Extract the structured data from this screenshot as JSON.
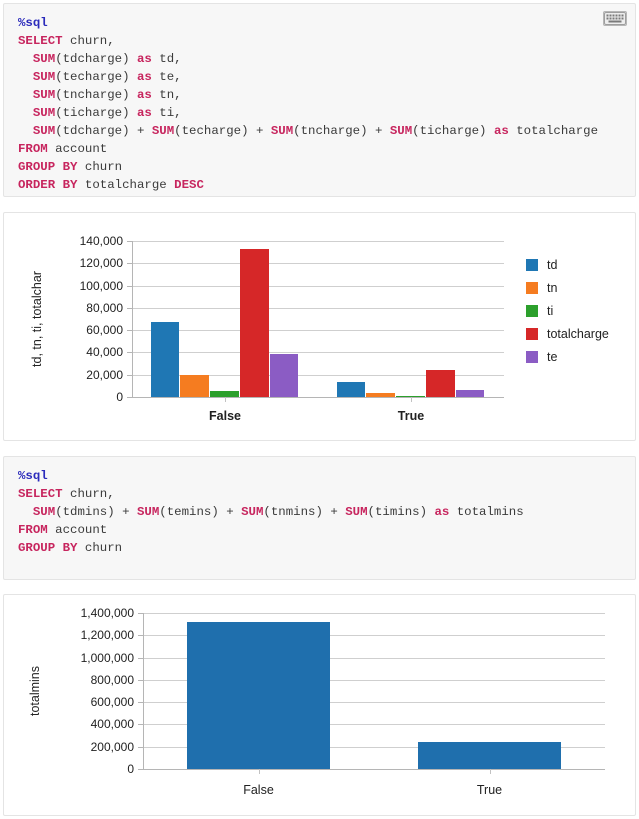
{
  "notebook": {
    "keyboard_icon": "keyboard-icon"
  },
  "cells": [
    {
      "type": "code",
      "name": "sql-cell-1",
      "lines": [
        [
          {
            "t": "magic",
            "s": "%sql"
          }
        ],
        [
          {
            "t": "kw",
            "s": "SELECT"
          },
          {
            "t": "plain",
            "s": " churn,"
          }
        ],
        [
          {
            "t": "plain",
            "s": "  "
          },
          {
            "t": "fn",
            "s": "SUM"
          },
          {
            "t": "plain",
            "s": "(tdcharge) "
          },
          {
            "t": "kw",
            "s": "as"
          },
          {
            "t": "plain",
            "s": " td,"
          }
        ],
        [
          {
            "t": "plain",
            "s": "  "
          },
          {
            "t": "fn",
            "s": "SUM"
          },
          {
            "t": "plain",
            "s": "(techarge) "
          },
          {
            "t": "kw",
            "s": "as"
          },
          {
            "t": "plain",
            "s": " te,"
          }
        ],
        [
          {
            "t": "plain",
            "s": "  "
          },
          {
            "t": "fn",
            "s": "SUM"
          },
          {
            "t": "plain",
            "s": "(tncharge) "
          },
          {
            "t": "kw",
            "s": "as"
          },
          {
            "t": "plain",
            "s": " tn,"
          }
        ],
        [
          {
            "t": "plain",
            "s": "  "
          },
          {
            "t": "fn",
            "s": "SUM"
          },
          {
            "t": "plain",
            "s": "(ticharge) "
          },
          {
            "t": "kw",
            "s": "as"
          },
          {
            "t": "plain",
            "s": " ti,"
          }
        ],
        [
          {
            "t": "plain",
            "s": "  "
          },
          {
            "t": "fn",
            "s": "SUM"
          },
          {
            "t": "plain",
            "s": "(tdcharge) + "
          },
          {
            "t": "fn",
            "s": "SUM"
          },
          {
            "t": "plain",
            "s": "(techarge) + "
          },
          {
            "t": "fn",
            "s": "SUM"
          },
          {
            "t": "plain",
            "s": "(tncharge) + "
          },
          {
            "t": "fn",
            "s": "SUM"
          },
          {
            "t": "plain",
            "s": "(ticharge) "
          },
          {
            "t": "kw",
            "s": "as"
          },
          {
            "t": "plain",
            "s": " totalcharge"
          }
        ],
        [
          {
            "t": "kw",
            "s": "FROM"
          },
          {
            "t": "plain",
            "s": " account"
          }
        ],
        [
          {
            "t": "kw",
            "s": "GROUP BY"
          },
          {
            "t": "plain",
            "s": " churn"
          }
        ],
        [
          {
            "t": "kw",
            "s": "ORDER BY"
          },
          {
            "t": "plain",
            "s": " totalcharge "
          },
          {
            "t": "kw",
            "s": "DESC"
          }
        ]
      ]
    },
    {
      "type": "code",
      "name": "sql-cell-2",
      "lines": [
        [
          {
            "t": "magic",
            "s": "%sql"
          }
        ],
        [
          {
            "t": "kw",
            "s": "SELECT"
          },
          {
            "t": "plain",
            "s": " churn,"
          }
        ],
        [
          {
            "t": "plain",
            "s": "  "
          },
          {
            "t": "fn",
            "s": "SUM"
          },
          {
            "t": "plain",
            "s": "(tdmins) + "
          },
          {
            "t": "fn",
            "s": "SUM"
          },
          {
            "t": "plain",
            "s": "(temins) + "
          },
          {
            "t": "fn",
            "s": "SUM"
          },
          {
            "t": "plain",
            "s": "(tnmins) + "
          },
          {
            "t": "fn",
            "s": "SUM"
          },
          {
            "t": "plain",
            "s": "(timins) "
          },
          {
            "t": "kw",
            "s": "as"
          },
          {
            "t": "plain",
            "s": " totalmins"
          }
        ],
        [
          {
            "t": "kw",
            "s": "FROM"
          },
          {
            "t": "plain",
            "s": " account"
          }
        ],
        [
          {
            "t": "kw",
            "s": "GROUP BY"
          },
          {
            "t": "plain",
            "s": " churn"
          }
        ]
      ]
    }
  ],
  "chart_data": [
    {
      "type": "bar",
      "name": "charges-by-churn",
      "title": "",
      "xlabel": "",
      "ylabel": "td, tn, ti, totalchar",
      "ylabel_full": "td, tn, ti, totalcharge",
      "categories": [
        "False",
        "True"
      ],
      "series": [
        {
          "name": "td",
          "color": "#1f77b4",
          "values": [
            67500,
            13200
          ]
        },
        {
          "name": "tn",
          "color": "#f57c20",
          "values": [
            20100,
            3300
          ]
        },
        {
          "name": "ti",
          "color": "#2ca02c",
          "values": [
            5600,
            1000
          ]
        },
        {
          "name": "totalcharge",
          "color": "#d62728",
          "values": [
            133000,
            24600
          ]
        },
        {
          "name": "te",
          "color": "#8b5cc4",
          "values": [
            38600,
            6300
          ]
        }
      ],
      "ylim": [
        0,
        140000
      ],
      "yticks": [
        0,
        20000,
        40000,
        60000,
        80000,
        100000,
        120000,
        140000
      ],
      "ytick_labels": [
        "0",
        "20,000",
        "40,000",
        "60,000",
        "80,000",
        "100,000",
        "120,000",
        "140,000"
      ],
      "grid": true,
      "legend_position": "right",
      "legend_entries": [
        "td",
        "tn",
        "ti",
        "totalcharge",
        "te"
      ]
    },
    {
      "type": "bar",
      "name": "totalmins-by-churn",
      "title": "",
      "xlabel": "",
      "ylabel": "totalmins",
      "categories": [
        "False",
        "True"
      ],
      "series": [
        {
          "name": "totalmins",
          "color": "#1f6fad",
          "values": [
            1322000,
            240000
          ]
        }
      ],
      "ylim": [
        0,
        1400000
      ],
      "yticks": [
        0,
        200000,
        400000,
        600000,
        800000,
        1000000,
        1200000,
        1400000
      ],
      "ytick_labels": [
        "0",
        "200,000",
        "400,000",
        "600,000",
        "800,000",
        "1,000,000",
        "1,200,000",
        "1,400,000"
      ],
      "grid": true,
      "legend_position": "none",
      "legend_entries": []
    }
  ]
}
